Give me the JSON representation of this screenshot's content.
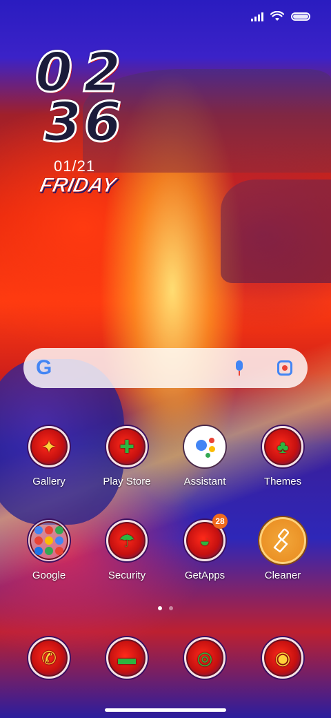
{
  "status_bar": {
    "signal_icon": "signal-icon",
    "wifi_icon": "wifi-icon",
    "battery_icon": "battery-icon"
  },
  "clock": {
    "hour_digits": [
      "0",
      "2"
    ],
    "minute_digits": [
      "3",
      "6"
    ],
    "date": "01/21",
    "day": "FRIDAY"
  },
  "search": {
    "logo": "G",
    "mic_icon": "mic-icon",
    "lens_icon": "lens-icon"
  },
  "apps_row1": [
    {
      "label": "Gallery"
    },
    {
      "label": "Play Store"
    },
    {
      "label": "Assistant"
    },
    {
      "label": "Themes"
    }
  ],
  "apps_row2": [
    {
      "label": "Google"
    },
    {
      "label": "Security"
    },
    {
      "label": "GetApps",
      "badge": "28"
    },
    {
      "label": "Cleaner"
    }
  ],
  "pager": {
    "pages": 2,
    "current": 1
  },
  "colors": {
    "accent_orange": "#e8891e",
    "badge": "#f06a1c",
    "google_blue": "#4285f4",
    "google_red": "#ea4335",
    "google_yellow": "#fbbc05",
    "google_green": "#34a853"
  }
}
